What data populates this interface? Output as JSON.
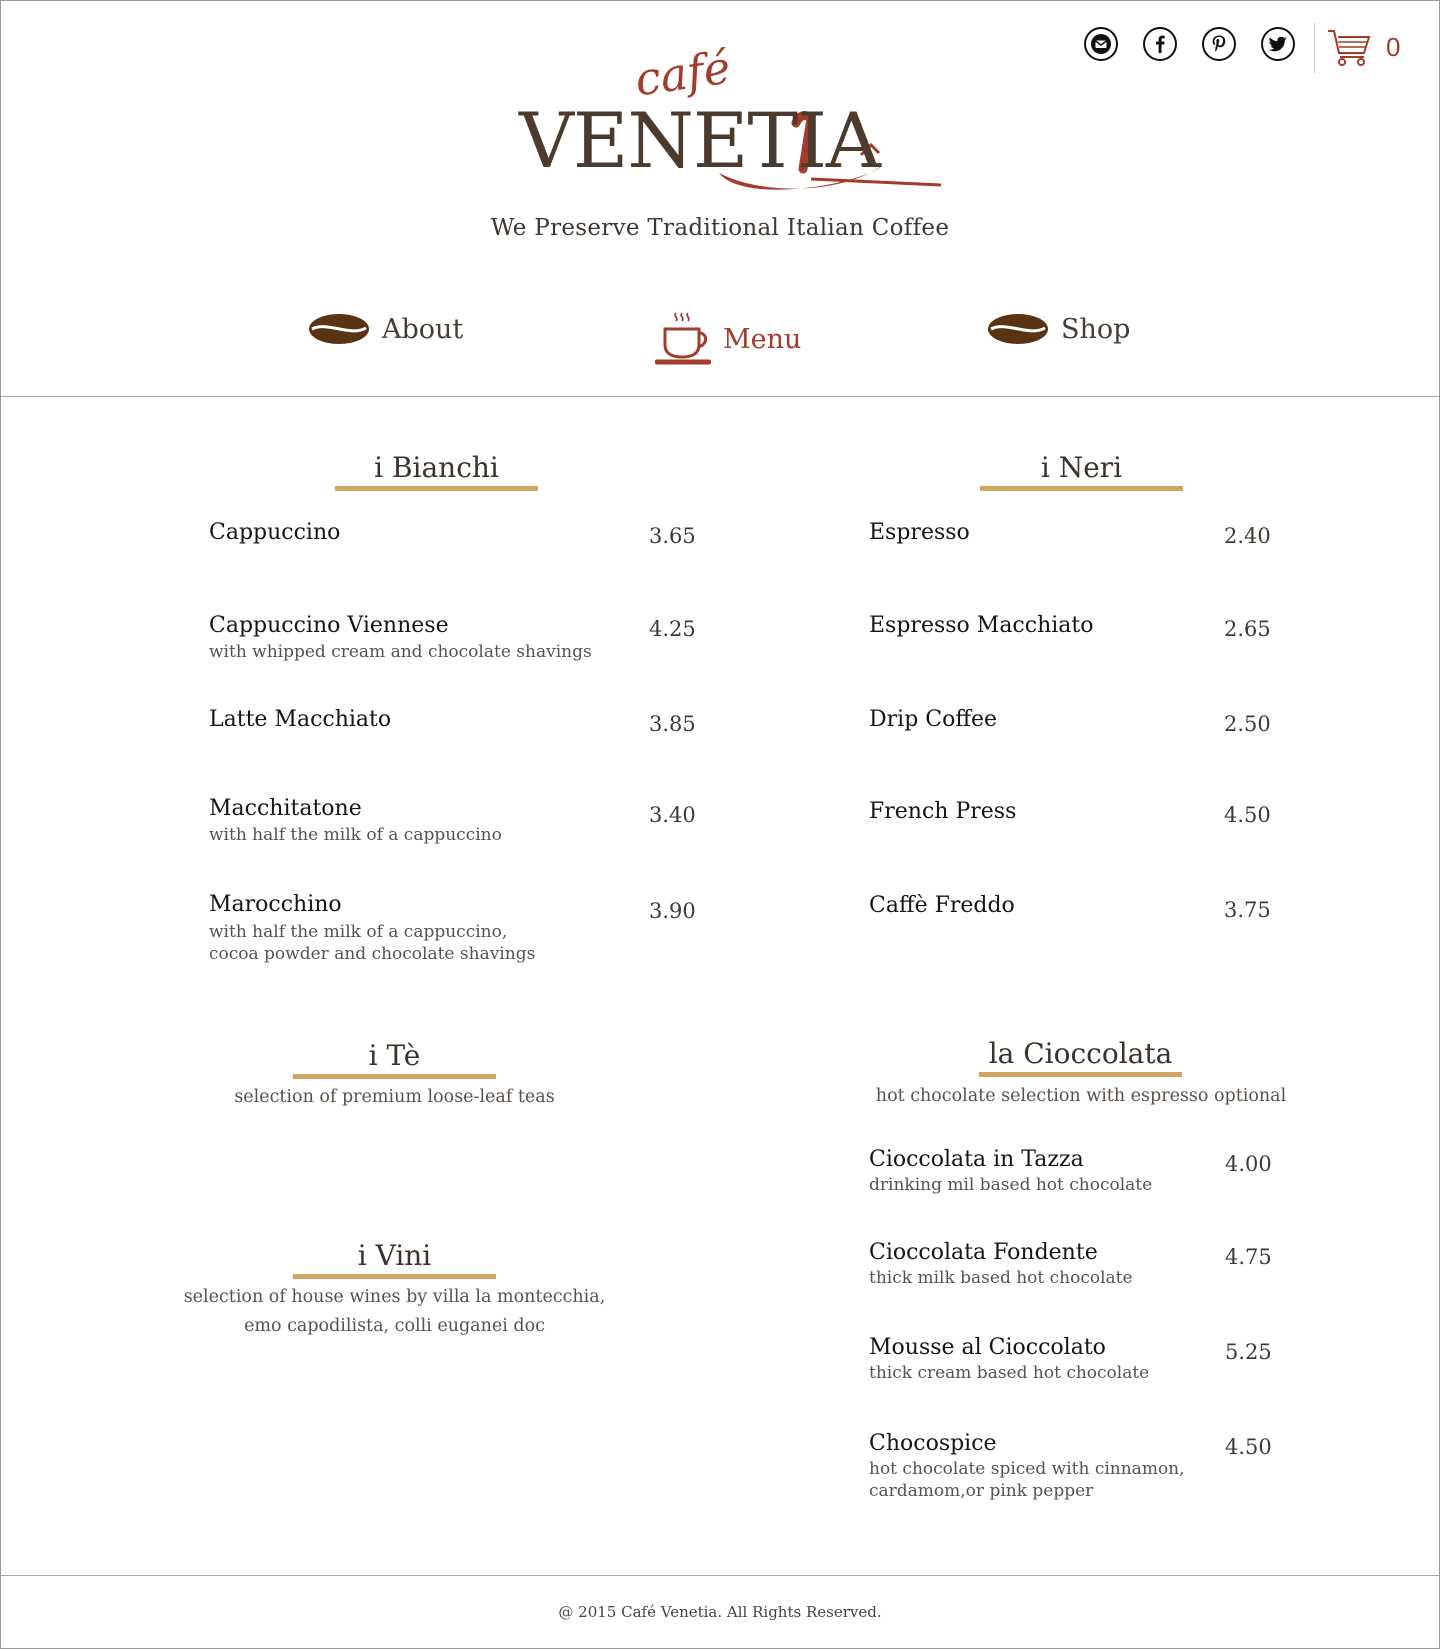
{
  "header": {
    "social": [
      {
        "name": "email-icon",
        "glyph": "✉"
      },
      {
        "name": "facebook-icon",
        "glyph": "f"
      },
      {
        "name": "pinterest-icon",
        "glyph": "P"
      },
      {
        "name": "twitter-icon",
        "glyph": "🐦"
      }
    ],
    "cart_count": "0",
    "logo": {
      "cafe": "café",
      "venetia": "VENETIA"
    },
    "tagline": "We Preserve Traditional Italian Coffee"
  },
  "nav": {
    "about": "About",
    "menu": "Menu",
    "shop": "Shop"
  },
  "menu": {
    "bianchi": {
      "title": "i Bianchi",
      "items": [
        {
          "name": "Cappuccino",
          "desc": "",
          "price": "3.65"
        },
        {
          "name": "Cappuccino Viennese",
          "desc": "with whipped cream and chocolate shavings",
          "price": "4.25"
        },
        {
          "name": "Latte Macchiato",
          "desc": "",
          "price": "3.85"
        },
        {
          "name": "Macchitatone",
          "desc": "with half the milk of a cappuccino",
          "price": "3.40"
        },
        {
          "name": "Marocchino",
          "desc": "with half the milk of a cappuccino,",
          "desc2": "cocoa powder and chocolate shavings",
          "price": "3.90"
        }
      ]
    },
    "neri": {
      "title": "i Neri",
      "items": [
        {
          "name": "Espresso",
          "price": "2.40"
        },
        {
          "name": "Espresso Macchiato",
          "price": "2.65"
        },
        {
          "name": "Drip Coffee",
          "price": "2.50"
        },
        {
          "name": "French Press",
          "price": "4.50"
        },
        {
          "name": "Caffè Freddo",
          "price": "3.75"
        }
      ]
    },
    "te": {
      "title": "i Tè",
      "note": "selection of premium loose-leaf teas"
    },
    "vini": {
      "title": "i Vini",
      "note1": "selection of house wines by villa la montecchia,",
      "note2": "emo capodilista, colli euganei doc"
    },
    "cioccolata": {
      "title": "la Cioccolata",
      "note": "hot chocolate selection with espresso optional",
      "items": [
        {
          "name": "Cioccolata in Tazza",
          "desc": "drinking mil based hot chocolate",
          "price": "4.00"
        },
        {
          "name": "Cioccolata Fondente",
          "desc": "thick milk based hot chocolate",
          "price": "4.75"
        },
        {
          "name": "Mousse al Cioccolato",
          "desc": "thick cream based hot chocolate",
          "price": "5.25"
        },
        {
          "name": "Chocospice",
          "desc": "hot chocolate spiced with cinnamon,",
          "desc2": "cardamom,or pink pepper",
          "price": "4.50"
        }
      ]
    }
  },
  "footer": {
    "copyright": "@ 2015 Café Venetia. All Rights Reserved."
  },
  "colors": {
    "accent": "#a23c2c",
    "brown": "#4b3a2e",
    "gold": "#d4a560",
    "bean": "#5a3312"
  }
}
